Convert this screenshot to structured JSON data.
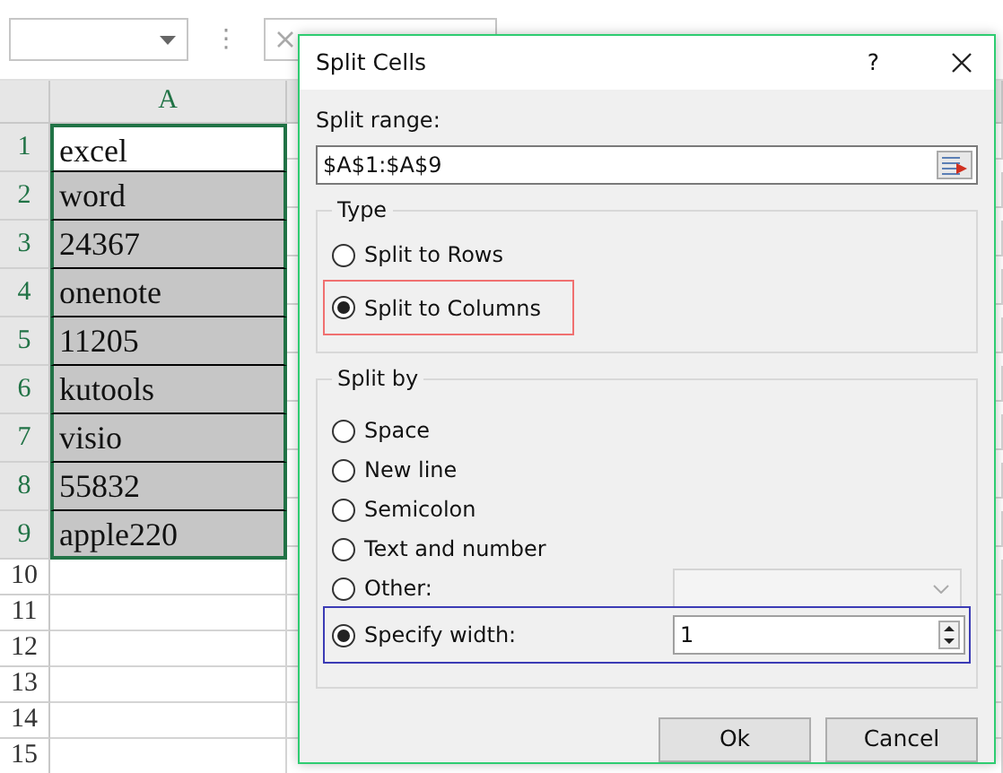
{
  "toolbar": {
    "separator": "⋮"
  },
  "column_header": "A",
  "rows": [
    {
      "number": "1",
      "value": "excel",
      "selected": false
    },
    {
      "number": "2",
      "value": "word",
      "selected": true
    },
    {
      "number": "3",
      "value": "24367",
      "selected": true
    },
    {
      "number": "4",
      "value": "onenote",
      "selected": true
    },
    {
      "number": "5",
      "value": "11205",
      "selected": true
    },
    {
      "number": "6",
      "value": "kutools",
      "selected": true
    },
    {
      "number": "7",
      "value": "visio",
      "selected": true
    },
    {
      "number": "8",
      "value": "55832",
      "selected": true
    },
    {
      "number": "9",
      "value": "apple220",
      "selected": true
    }
  ],
  "empty_rows": [
    "10",
    "11",
    "12",
    "13",
    "14",
    "15"
  ],
  "dialog": {
    "title": "Split Cells",
    "help": "?",
    "split_range": {
      "label": "Split range:",
      "value": "$A$1:$A$9"
    },
    "type_group": {
      "legend": "Type",
      "options": [
        {
          "label": "Split to Rows",
          "selected": false,
          "highlighted": false
        },
        {
          "label": "Split to Columns",
          "selected": true,
          "highlighted": true
        }
      ]
    },
    "split_by": {
      "legend": "Split by",
      "options": [
        {
          "kind": "plain",
          "label": "Space",
          "selected": false
        },
        {
          "kind": "plain",
          "label": "New line",
          "selected": false
        },
        {
          "kind": "plain",
          "label": "Semicolon",
          "selected": false
        },
        {
          "kind": "plain",
          "label": "Text and number",
          "selected": false
        },
        {
          "kind": "combo",
          "label": "Other:",
          "selected": false
        },
        {
          "kind": "spin",
          "label": "Specify width:",
          "selected": true,
          "highlighted": true,
          "value": "1"
        }
      ]
    },
    "buttons": [
      "Ok",
      "Cancel"
    ]
  }
}
